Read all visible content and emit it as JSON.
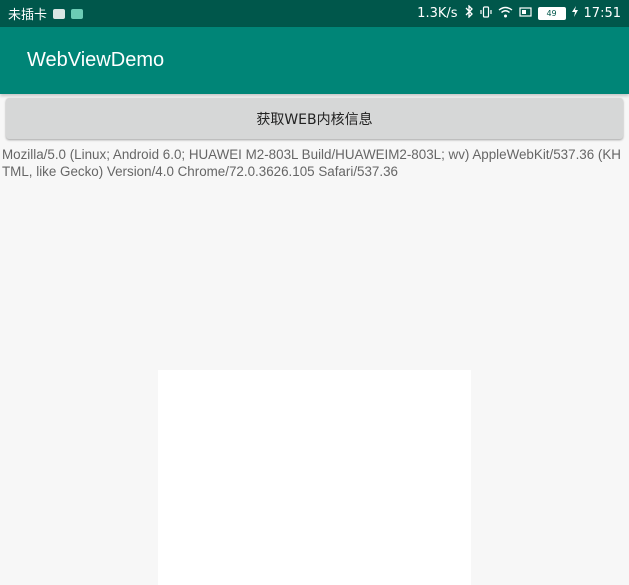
{
  "status_bar": {
    "carrier": "未插卡",
    "net_speed": "1.3K/s",
    "battery_level": "49",
    "time": "17:51",
    "icons": [
      "sim-icon",
      "app-notification-icon",
      "bluetooth-icon",
      "vibrate-icon",
      "wifi-icon",
      "data-icon",
      "battery-icon",
      "charging-icon"
    ],
    "background_color": "#00574b"
  },
  "app_bar": {
    "title": "WebViewDemo",
    "background_color": "#008577"
  },
  "main": {
    "get_info_button_label": "获取WEB内核信息",
    "user_agent_text": "Mozilla/5.0 (Linux; Android 6.0; HUAWEI M2-803L Build/HUAWEIM2-803L; wv) AppleWebKit/537.36 (KHTML, like Gecko) Version/4.0 Chrome/72.0.3626.105 Safari/537.36"
  }
}
